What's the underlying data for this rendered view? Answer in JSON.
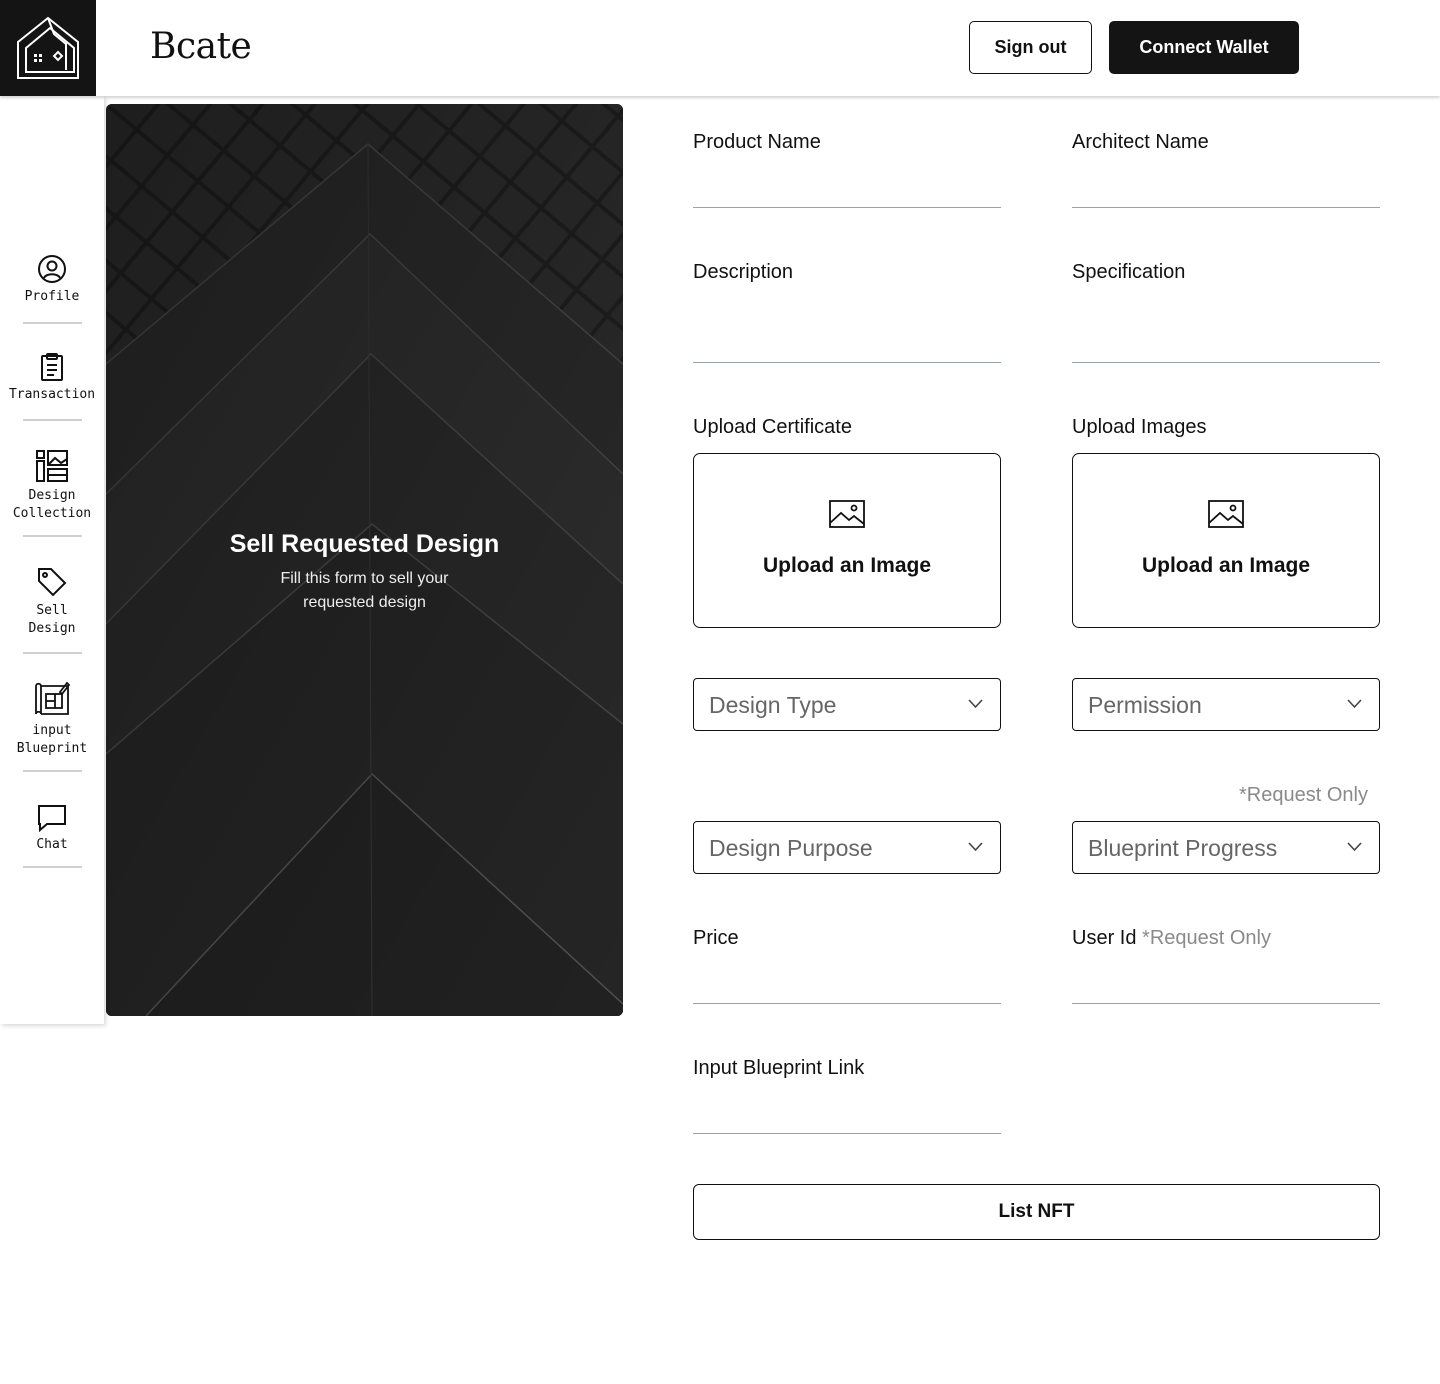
{
  "app": {
    "brand": "Bcate"
  },
  "header": {
    "sign_out_label": "Sign out",
    "connect_wallet_label": "Connect Wallet"
  },
  "sidebar": {
    "items": [
      {
        "label": "Profile",
        "icon": "user-circle-icon"
      },
      {
        "label": "Transaction",
        "icon": "clipboard-icon"
      },
      {
        "label": "Design Collection",
        "icon": "layout-icon"
      },
      {
        "label": "Sell Design",
        "icon": "tag-icon"
      },
      {
        "label": "input Blueprint",
        "icon": "blueprint-icon"
      },
      {
        "label": "Chat",
        "icon": "chat-bubble-icon"
      }
    ]
  },
  "hero": {
    "title": "Sell Requested Design",
    "subtitle": "Fill this form to sell your requested design"
  },
  "form": {
    "product_name_label": "Product Name",
    "architect_name_label": "Architect Name",
    "description_label": "Description",
    "specification_label": "Specification",
    "upload_certificate_label": "Upload Certificate",
    "upload_images_label": "Upload Images",
    "upload_prompt": "Upload an Image",
    "design_type_placeholder": "Design Type",
    "permission_placeholder": "Permission",
    "request_only_note": "*Request Only",
    "design_purpose_placeholder": "Design Purpose",
    "blueprint_progress_placeholder": "Blueprint Progress",
    "price_label": "Price",
    "user_id_label": "User Id",
    "user_id_note": "*Request Only",
    "blueprint_link_label": "Input Blueprint Link",
    "submit_label": "List NFT"
  }
}
